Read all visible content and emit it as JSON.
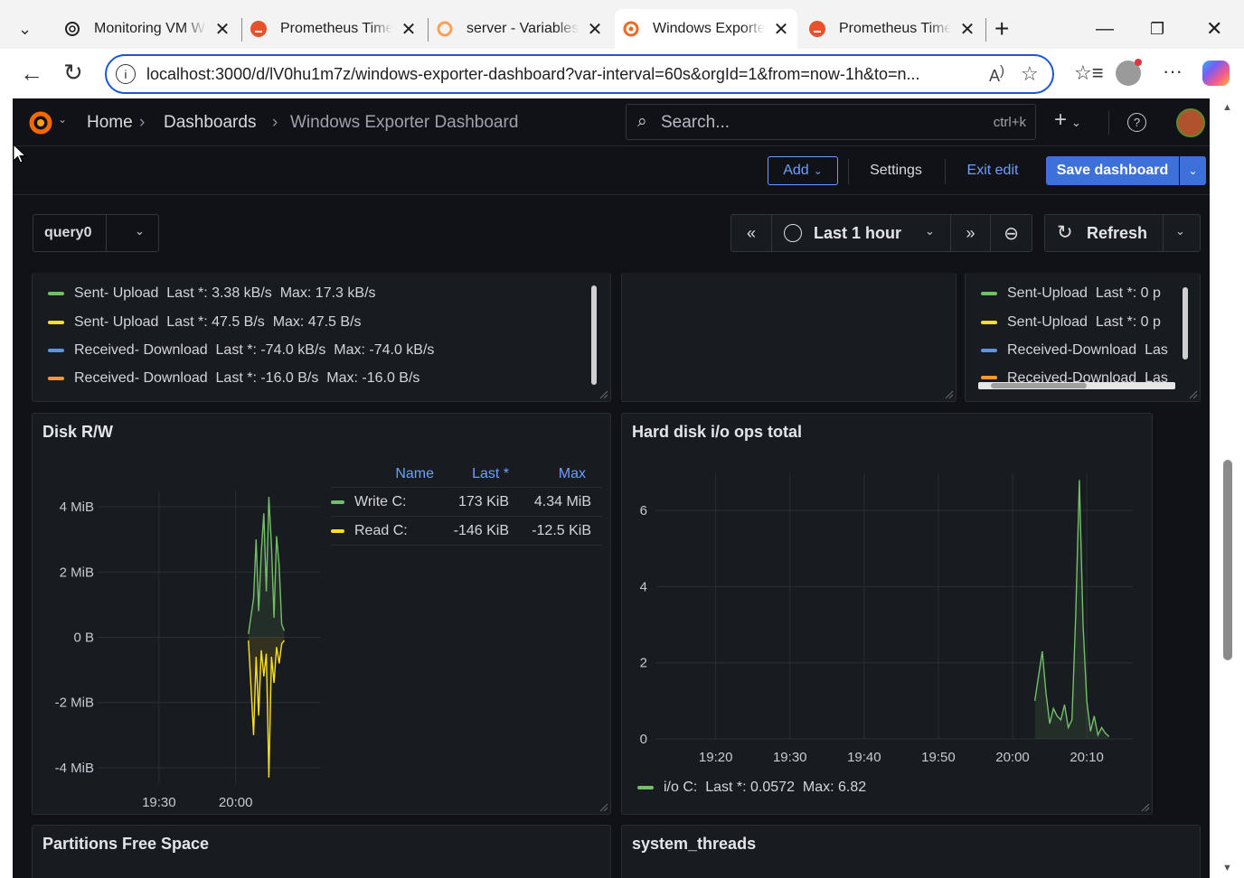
{
  "browser": {
    "tabs": [
      {
        "title": "Monitoring VM Windows",
        "icon": "openai-icon"
      },
      {
        "title": "Prometheus Time Series",
        "icon": "prometheus-icon"
      },
      {
        "title": "server - Variables",
        "icon": "grafana-icon"
      },
      {
        "title": "Windows Exporter Dashboard",
        "icon": "grafana-icon",
        "active": true
      },
      {
        "title": "Prometheus Time Series",
        "icon": "prometheus-icon"
      }
    ],
    "url": "localhost:3000/d/lV0hu1m7z/windows-exporter-dashboard?var-interval=60s&orgId=1&from=now-1h&to=n..."
  },
  "nav": {
    "home": "Home",
    "dashboards": "Dashboards",
    "current": "Windows Exporter Dashboard",
    "search_placeholder": "Search...",
    "search_shortcut": "ctrl+k"
  },
  "actions": {
    "add": "Add",
    "settings": "Settings",
    "exit_edit": "Exit edit",
    "save": "Save dashboard"
  },
  "variables": {
    "query_label": "query0"
  },
  "time": {
    "range": "Last 1 hour",
    "refresh": "Refresh"
  },
  "network_panel_left": {
    "legend": [
      {
        "name": "Sent- Upload",
        "last": "Last *: 3.38 kB/s",
        "max": "Max: 17.3 kB/s",
        "color": "#73bf69"
      },
      {
        "name": "Sent- Upload",
        "last": "Last *: 47.5 B/s",
        "max": "Max: 47.5 B/s",
        "color": "#fade2a"
      },
      {
        "name": "Received- Download",
        "last": "Last *: -74.0 kB/s",
        "max": "Max: -74.0 kB/s",
        "color": "#5794f2"
      },
      {
        "name": "Received- Download",
        "last": "Last *: -16.0 B/s",
        "max": "Max: -16.0 B/s",
        "color": "#ff9830"
      }
    ]
  },
  "network_panel_right": {
    "legend": [
      {
        "name": "Sent-Upload",
        "last": "Last *: 0 p",
        "color": "#73bf69"
      },
      {
        "name": "Sent-Upload",
        "last": "Last *: 0 p",
        "color": "#fade2a"
      },
      {
        "name": "Received-Download",
        "last": "Las",
        "color": "#5794f2"
      },
      {
        "name": "Received-Download",
        "last": "Las",
        "color": "#ff9830"
      }
    ]
  },
  "disk_rw": {
    "title": "Disk R/W",
    "table_headers": [
      "Name",
      "Last *",
      "Max"
    ],
    "rows": [
      {
        "name": "Write C:",
        "last": "173 KiB",
        "max": "4.34 MiB",
        "color": "#73bf69"
      },
      {
        "name": "Read C:",
        "last": "-146 KiB",
        "max": "-12.5 KiB",
        "color": "#fade2a"
      }
    ]
  },
  "hdd_ops": {
    "title": "Hard disk i/o ops total",
    "legend": {
      "name": "i/o C:",
      "last": "Last *: 0.0572",
      "max": "Max: 6.82",
      "color": "#73bf69"
    }
  },
  "chart_data": [
    {
      "type": "line",
      "title": "Disk R/W",
      "y_ticks": [
        "4 MiB",
        "2 MiB",
        "0 B",
        "-2 MiB",
        "-4 MiB"
      ],
      "x_ticks": [
        "19:30",
        "20:00"
      ],
      "ylim": [
        -4.5,
        4.5
      ],
      "xlim": [
        19.1,
        20.55
      ],
      "series": [
        {
          "name": "Write C:",
          "color": "#73bf69",
          "x": [
            20.05,
            20.07,
            20.08,
            20.09,
            20.1,
            20.11,
            20.12,
            20.13,
            20.14,
            20.15,
            20.16,
            20.17,
            20.18,
            20.19
          ],
          "values": [
            0.1,
            1.2,
            3.0,
            0.8,
            2.6,
            3.8,
            1.4,
            4.3,
            2.8,
            0.6,
            3.1,
            2.2,
            0.4,
            0.2
          ]
        },
        {
          "name": "Read C:",
          "color": "#fade2a",
          "x": [
            20.05,
            20.07,
            20.08,
            20.09,
            20.1,
            20.11,
            20.12,
            20.13,
            20.14,
            20.15,
            20.16,
            20.17,
            20.18,
            20.19
          ],
          "values": [
            -0.1,
            -3.0,
            -0.6,
            -2.4,
            -0.4,
            -1.2,
            -0.5,
            -4.3,
            -0.6,
            -1.4,
            -0.3,
            -0.8,
            -0.2,
            -0.1
          ]
        }
      ]
    },
    {
      "type": "area",
      "title": "Hard disk i/o ops total",
      "y_ticks": [
        "6",
        "4",
        "2",
        "0"
      ],
      "x_ticks": [
        "19:20",
        "19:30",
        "19:40",
        "19:50",
        "20:00",
        "20:10"
      ],
      "ylim": [
        0,
        7
      ],
      "xlim": [
        19.2,
        20.27
      ],
      "series": [
        {
          "name": "i/o C:",
          "color": "#73bf69",
          "x": [
            20.03,
            20.04,
            20.045,
            20.05,
            20.055,
            20.06,
            20.065,
            20.07,
            20.075,
            20.08,
            20.085,
            20.09,
            20.095,
            20.1,
            20.105,
            20.11,
            20.115,
            20.12,
            20.125,
            20.13
          ],
          "values": [
            1.0,
            2.3,
            1.2,
            0.4,
            0.8,
            0.6,
            0.5,
            0.9,
            0.3,
            0.5,
            3.2,
            6.8,
            3.0,
            1.0,
            0.2,
            0.6,
            0.1,
            0.3,
            0.15,
            0.06
          ]
        }
      ]
    }
  ],
  "bottom_panels": {
    "left_title": "Partitions Free Space",
    "right_title": "system_threads"
  }
}
